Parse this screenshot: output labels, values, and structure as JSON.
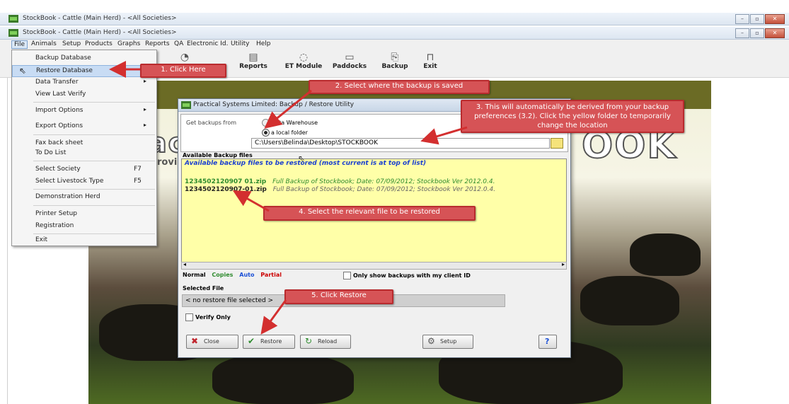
{
  "window1": {
    "title": "StockBook - Cattle (Main Herd) - <All Societies>"
  },
  "window2": {
    "title": "StockBook - Cattle (Main Herd) - <All Societies>"
  },
  "menubar": {
    "items": [
      "File",
      "Animals",
      "Setup",
      "Products",
      "Graphs",
      "Reports",
      "QA",
      "Electronic Id.",
      "Utility",
      "Help"
    ]
  },
  "toolbar": {
    "items": [
      "Reports",
      "ET Module",
      "Paddocks",
      "Backup",
      "Exit"
    ]
  },
  "file_menu": {
    "items": [
      {
        "label": "Backup Database",
        "key": "",
        "submenu": false
      },
      {
        "label": "Restore Database",
        "key": "",
        "submenu": false
      },
      {
        "label": "Data Transfer",
        "key": "",
        "submenu": true
      },
      {
        "label": "View Last Verify",
        "key": "",
        "submenu": false
      },
      {
        "label": "Import Options",
        "key": "",
        "submenu": true
      },
      {
        "label": "Export Options",
        "key": "",
        "submenu": true
      },
      {
        "label": "Fax back sheet",
        "key": "",
        "submenu": false
      },
      {
        "label": "To Do List",
        "key": "",
        "submenu": false
      },
      {
        "label": "Select Society",
        "key": "F7",
        "submenu": false
      },
      {
        "label": "Select Livestock Type",
        "key": "F5",
        "submenu": false
      },
      {
        "label": "Demonstration Herd",
        "key": "",
        "submenu": false
      },
      {
        "label": "Printer Setup",
        "key": "",
        "submenu": false
      },
      {
        "label": "Registration",
        "key": "",
        "submenu": false
      },
      {
        "label": "Exit",
        "key": "",
        "submenu": false
      }
    ]
  },
  "dialog": {
    "title": "Practical Systems Limited: Backup / Restore Utility",
    "get_backups_from_label": "Get backups from",
    "option_data_warehouse": "Data Warehouse",
    "option_local_folder": "a local folder",
    "path_value": "C:\\Users\\Belinda\\Desktop\\STOCKBOOK",
    "available_label": "Available Backup files",
    "available_hint": "Available backup files to be restored (most current is at top of list)",
    "files": [
      {
        "name": "1234502120907 01.zip",
        "desc": "Full Backup of Stockbook; Date: 07/09/2012; Stockbook Ver 2012.0.4."
      },
      {
        "name": "1234502120907-01.zip",
        "desc": "Full Backup of Stockbook; Date: 07/09/2012; Stockbook Ver 2012.0.4."
      }
    ],
    "legend": {
      "normal": "Normal",
      "copies": "Copies",
      "auto": "Auto",
      "partial": "Partial"
    },
    "only_show_label": "Only show backups with my client ID",
    "selected_file_label": "Selected File",
    "selected_file_value": "< no restore file selected >",
    "verify_only_label": "Verify Only",
    "buttons": {
      "close": "Close",
      "restore": "Restore",
      "reload": "Reload",
      "setup": "Setup",
      "help": "?"
    }
  },
  "banner": {
    "text_left": "ac",
    "text_left2": "rovi",
    "text_right": "OOK"
  },
  "callouts": {
    "c1": "1. Click Here",
    "c2": "2. Select where the backup is saved",
    "c3": "3. This will automatically be derived from your backup preferences (3.2). Click the yellow folder to temporarily change the location",
    "c4": "4. Select the relevant file to be restored",
    "c5": "5. Click Restore"
  },
  "colors": {
    "callout": "#d65356",
    "file_list_bg": "#ffffa8",
    "partial": "#cc0000",
    "copies": "#2e8b2e",
    "auto": "#1a4fd6"
  }
}
